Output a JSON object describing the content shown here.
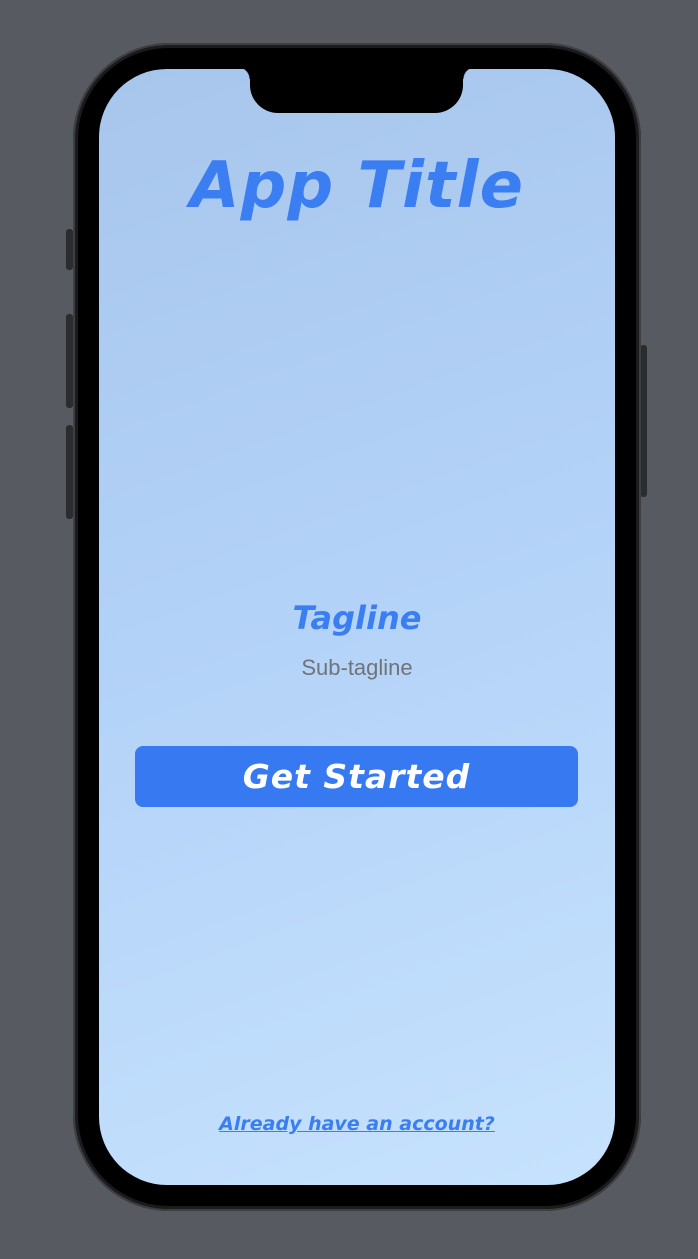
{
  "app": {
    "title": "App Title",
    "tagline": "Tagline",
    "subtagline": "Sub-tagline",
    "cta_label": "Get Started",
    "login_link": "Already have an account?"
  },
  "colors": {
    "accent": "#3779f1",
    "background_top": "#a8c6ec",
    "background_bottom": "#c6e2fd",
    "subtext": "#6f7479",
    "device_frame": "#1b1b1d",
    "backdrop": "#575b61"
  }
}
